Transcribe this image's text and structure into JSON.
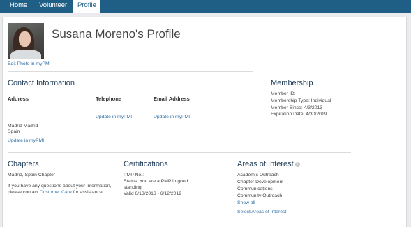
{
  "nav": {
    "tabs": [
      {
        "label": "Home"
      },
      {
        "label": "Volunteer"
      },
      {
        "label": "Profile"
      }
    ]
  },
  "profile": {
    "title": "Susana Moreno's Profile",
    "edit_photo_link": "Edit Photo in myPMI"
  },
  "contact": {
    "heading": "Contact Information",
    "address_label": "Address",
    "telephone_label": "Telephone",
    "email_label": "Email Address",
    "telephone_link": "Update in myPMI",
    "email_link": "Update in myPMI",
    "address_line1": "Madrid Madrid",
    "address_line2": "Spain",
    "address_link": "Update in myPMI"
  },
  "membership": {
    "heading": "Membership",
    "member_id": "Member ID:",
    "membership_type": "Membership Type: Individual",
    "member_since": "Member Since: 4/3/2013",
    "expiration_date": "Expiration Date: 4/30/2019"
  },
  "chapters": {
    "heading": "Chapters",
    "chapter": "Madrid, Spain Chapter",
    "help_line1": "If you have any questions about your information,",
    "help_line2_prefix": "please contact ",
    "help_link": "Customer Care",
    "help_line2_suffix": " for assistance."
  },
  "certifications": {
    "heading": "Certifications",
    "pmp_no": "PMP No.:",
    "status_line1": "Status: You are a PMP in good",
    "status_line2": "standing",
    "valid": "Valid 6/13/2013 - 6/12/2019"
  },
  "interests": {
    "heading": "Areas of Interest",
    "info_icon": "i",
    "items": [
      "Academic Outreach",
      "Chapter Development",
      "Communications",
      "Community Outreach"
    ],
    "show_all": "Show all",
    "select_link": "Select Areas of Interest"
  },
  "colors": {
    "navbar": "#1f5f86",
    "link": "#2c6fa6",
    "heading": "#1e3b57"
  }
}
